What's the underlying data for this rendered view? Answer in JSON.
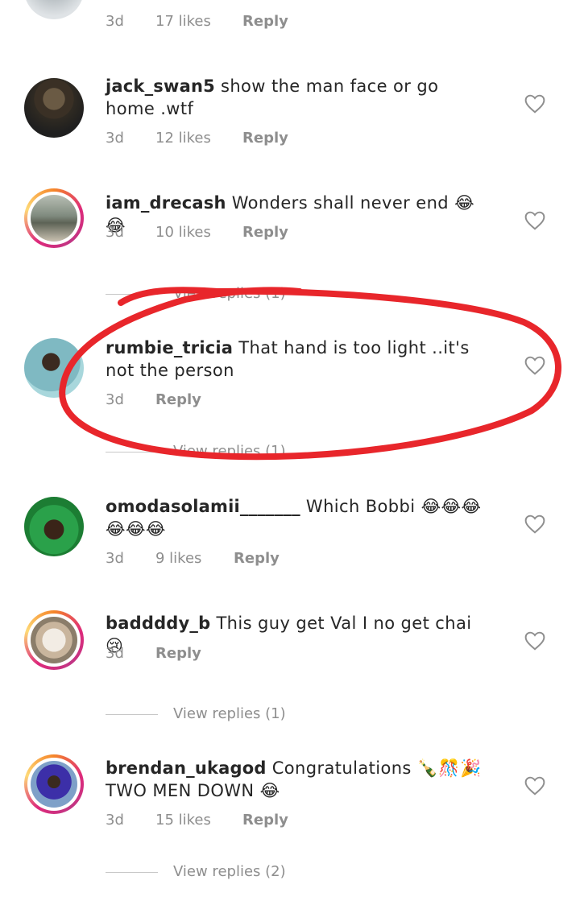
{
  "comments": [
    {
      "time": "3d",
      "likes": "17 likes",
      "reply": "Reply"
    },
    {
      "user": "jack_swan5",
      "text": "show the man face or go home .wtf",
      "time": "3d",
      "likes": "12 likes",
      "reply": "Reply"
    },
    {
      "user": "iam_drecash",
      "text": "Wonders shall never end 😂😂",
      "time": "3d",
      "likes": "10 likes",
      "reply": "Reply",
      "view_replies": "View replies (1)"
    },
    {
      "user": "rumbie_tricia",
      "text": "That hand is too light ..it's not the person",
      "time": "3d",
      "reply": "Reply",
      "view_replies": "View replies (1)"
    },
    {
      "user": "omodasolamii_______",
      "text": "Which Bobbi 😂😂😂😂😂😂",
      "time": "3d",
      "likes": "9 likes",
      "reply": "Reply"
    },
    {
      "user": "baddddy_b",
      "text": "This guy get Val I no get chai 😢",
      "time": "3d",
      "reply": "Reply",
      "view_replies": "View replies (1)"
    },
    {
      "user": "brendan_ukagod",
      "text": "Congratulations 🍾🎊🎉 TWO MEN DOWN 😂",
      "time": "3d",
      "likes": "15 likes",
      "reply": "Reply",
      "view_replies": "View replies (2)"
    }
  ],
  "icons": {
    "like": "heart-outline-icon"
  },
  "colors": {
    "annotation": "#e8262b",
    "meta": "#8e8e8e",
    "ring_start": "#f58529",
    "ring_end": "#dd2a7b"
  }
}
